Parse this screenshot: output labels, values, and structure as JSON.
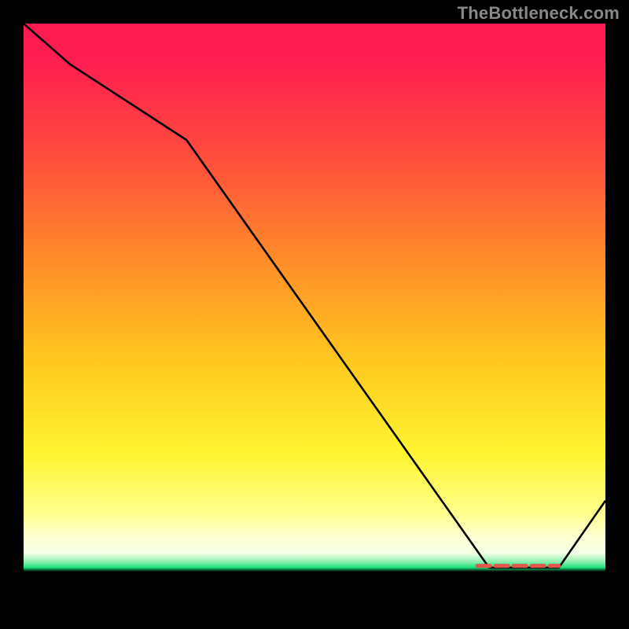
{
  "watermark": "TheBottleneck.com",
  "colors": {
    "background": "#000000",
    "watermark_text": "#888888",
    "gradient_top": "#ff1a52",
    "gradient_mid_orange": "#ff8a2a",
    "gradient_yellow": "#fff532",
    "gradient_pale": "#ffffd0",
    "gradient_green": "#19e27a",
    "curve_stroke": "#000000",
    "marker_stroke": "#e0584c"
  },
  "chart_data": {
    "type": "line",
    "title": "",
    "xlabel": "",
    "ylabel": "",
    "xlim": [
      0,
      100
    ],
    "ylim": [
      0,
      100
    ],
    "series": [
      {
        "name": "curve",
        "x": [
          0,
          8,
          28,
          80,
          82,
          92,
          100
        ],
        "y": [
          100,
          93,
          80,
          6.5,
          6.5,
          6.5,
          18
        ]
      }
    ],
    "marker_segment": {
      "name": "highlight-dash",
      "x": [
        78,
        92
      ],
      "y": [
        6.8,
        6.8
      ]
    },
    "notes": "Vertical gradient red→orange→yellow→pale→green, thin black bottom band. No tick labels or axis text visible."
  }
}
